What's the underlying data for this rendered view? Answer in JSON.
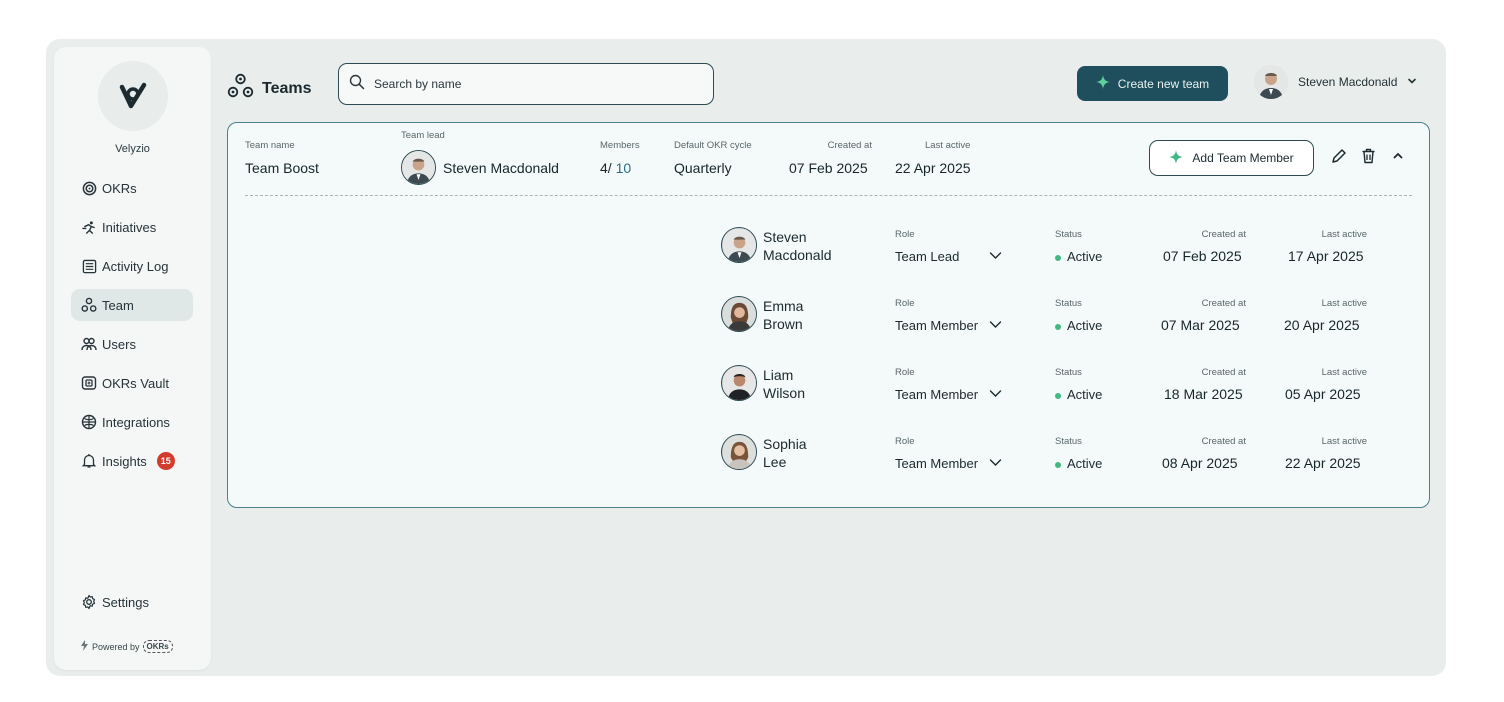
{
  "sidebar": {
    "brand": "Velyzio",
    "items": [
      {
        "label": "OKRs",
        "icon": "target-icon"
      },
      {
        "label": "Initiatives",
        "icon": "running-icon"
      },
      {
        "label": "Activity Log",
        "icon": "list-icon"
      },
      {
        "label": "Team",
        "icon": "team-icon",
        "active": true
      },
      {
        "label": "Users",
        "icon": "users-icon"
      },
      {
        "label": "OKRs Vault",
        "icon": "vault-icon"
      },
      {
        "label": "Integrations",
        "icon": "integrations-icon"
      },
      {
        "label": "Insights",
        "icon": "bell-icon",
        "badge": "15"
      }
    ],
    "settings_label": "Settings",
    "powered_by": "Powered by",
    "powered_logo": "OKRs"
  },
  "header": {
    "title": "Teams",
    "search_placeholder": "Search by name",
    "create_button": "Create new team",
    "user_name": "Steven Macdonald"
  },
  "team": {
    "labels": {
      "name": "Team name",
      "lead": "Team lead",
      "members": "Members",
      "cycle": "Default OKR cycle",
      "created": "Created at",
      "last_active": "Last active"
    },
    "name": "Team Boost",
    "lead": "Steven Macdonald",
    "members_count": "4",
    "members_separator": "/",
    "members_total": "10",
    "cycle": "Quarterly",
    "created": "07 Feb 2025",
    "last_active": "22 Apr 2025",
    "add_member_button": "Add Team Member"
  },
  "member_labels": {
    "role": "Role",
    "status": "Status",
    "created": "Created at",
    "last_active": "Last active"
  },
  "members": [
    {
      "first": "Steven",
      "last": "Macdonald",
      "role": "Team Lead",
      "status": "Active",
      "created": "07 Feb 2025",
      "last_active": "17 Apr 2025"
    },
    {
      "first": "Emma",
      "last": "Brown",
      "role": "Team Member",
      "status": "Active",
      "created": "07 Mar 2025",
      "last_active": "20 Apr 2025"
    },
    {
      "first": "Liam",
      "last": "Wilson",
      "role": "Team Member",
      "status": "Active",
      "created": "18 Mar 2025",
      "last_active": "05 Apr 2025"
    },
    {
      "first": "Sophia",
      "last": "Lee",
      "role": "Team Member",
      "status": "Active",
      "created": "08 Apr 2025",
      "last_active": "22 Apr 2025"
    }
  ],
  "colors": {
    "accent": "#1f4f5c",
    "status_active": "#42b883",
    "badge": "#d23c2f",
    "card_border": "#4d7f8b"
  }
}
